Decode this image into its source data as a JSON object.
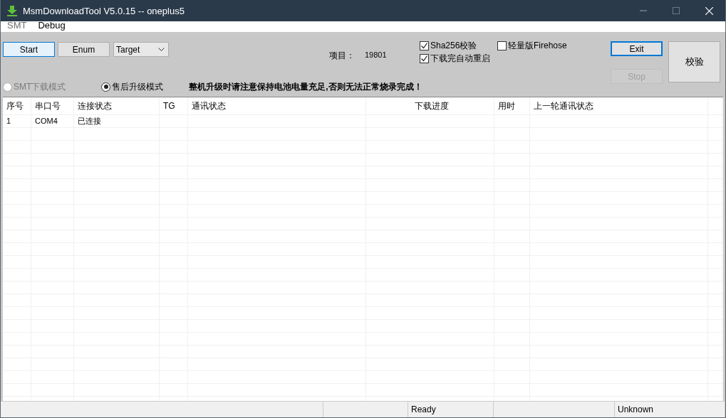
{
  "window": {
    "title": "MsmDownloadTool V5.0.15 -- oneplus5"
  },
  "menu": [
    {
      "label": "SMT",
      "disabled": true
    },
    {
      "label": "Debug",
      "disabled": false
    }
  ],
  "toolbar": {
    "buttons": [
      {
        "label": "Start",
        "focused": true
      },
      {
        "label": "Enum",
        "focused": false
      }
    ],
    "target_dropdown": {
      "value": "Target"
    },
    "project": {
      "label": "项目：",
      "value": "19801"
    },
    "checkboxes": [
      {
        "label": "Sha256校验",
        "checked": true
      },
      {
        "label": "下载完自动重启",
        "checked": true
      },
      {
        "label": "轻量版Firehose",
        "checked": false
      }
    ],
    "exit_button": {
      "label": "Exit",
      "focused": true
    },
    "stop_button": {
      "label": "Stop",
      "disabled": true
    },
    "verify_button": {
      "label": "校验"
    },
    "modes": [
      {
        "label": "SMT下载模式",
        "selected": false,
        "disabled": true
      },
      {
        "label": "售后升级模式",
        "selected": true,
        "disabled": false
      }
    ],
    "warning": "整机升级时请注意保持电池电量充足,否则无法正常烧录完成！"
  },
  "table": {
    "columns": [
      "序号",
      "串口号",
      "连接状态",
      "TG",
      "通讯状态",
      "下载进度",
      "用时",
      "上一轮通讯状态"
    ],
    "rows": [
      {
        "cells": [
          "1",
          "COM4",
          "已连接"
        ]
      }
    ]
  },
  "status_bar": [
    {
      "text": "Ready"
    },
    {
      "text": "Unknown"
    }
  ]
}
